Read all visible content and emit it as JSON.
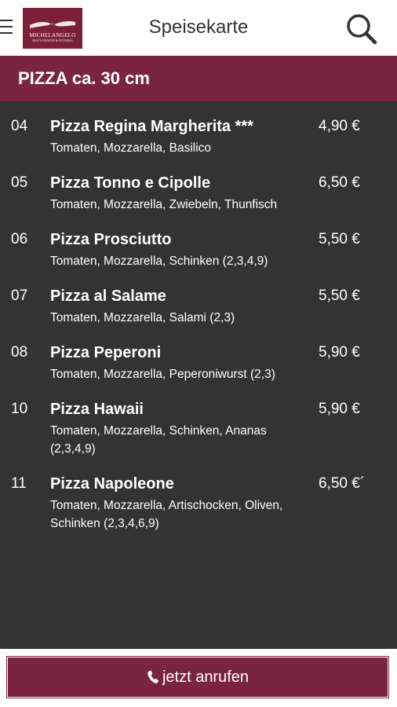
{
  "header": {
    "title": "Speisekarte",
    "logo": {
      "name": "MICHELANGELO",
      "subtitle": "RESTAURANTE & PIZZERIA"
    },
    "menu_icon": "hamburger-menu-icon",
    "search_icon": "search-icon"
  },
  "category": {
    "title": "PIZZA ca. 30 cm"
  },
  "items": [
    {
      "number": "04",
      "name": "Pizza Regina Margherita ***",
      "price": "4,90 €",
      "description": "Tomaten, Mozzarella, Basilico"
    },
    {
      "number": "05",
      "name": "Pizza Tonno e Cipolle",
      "price": "6,50 €",
      "description": "Tomaten, Mozzarella, Zwiebeln, Thunfisch"
    },
    {
      "number": "06",
      "name": "Pizza Prosciutto",
      "price": "5,50 €",
      "description": "Tomaten, Mozzarella, Schinken (2,3,4,9)"
    },
    {
      "number": "07",
      "name": "Pizza al Salame",
      "price": "5,50 €",
      "description": "Tomaten, Mozzarella, Salami (2,3)"
    },
    {
      "number": "08",
      "name": "Pizza Peperoni",
      "price": "5,90 €",
      "description": "Tomaten, Mozzarella, Peperoniwurst (2,3)"
    },
    {
      "number": "10",
      "name": "Pizza Hawaii",
      "price": "5,90 €",
      "description": "Tomaten, Mozzarella, Schinken, Ananas (2,3,4,9)"
    },
    {
      "number": "11",
      "name": "Pizza Napoleone",
      "price": "6,50 €´",
      "description": "Tomaten, Mozzarella, Artischocken, Oliven, Schinken (2,3,4,6,9)"
    }
  ],
  "call_button": {
    "label": "jetzt anrufen",
    "icon": "phone-icon"
  },
  "colors": {
    "accent": "#7a2442",
    "background": "#333333",
    "header_bg": "#ffffff"
  }
}
